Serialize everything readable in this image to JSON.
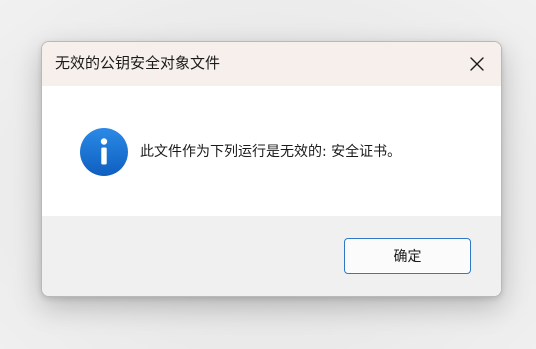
{
  "dialog": {
    "title": "无效的公钥安全对象文件",
    "message": "此文件作为下列运行是无效的: 安全证书。",
    "ok_label": "确定",
    "close_icon": "close-icon",
    "message_icon": "info-icon"
  },
  "colors": {
    "titlebar_bg": "#f7efec",
    "footer_bg": "#f0f0f0",
    "accent": "#2f78c8",
    "icon_blue": "#1a73d1"
  }
}
